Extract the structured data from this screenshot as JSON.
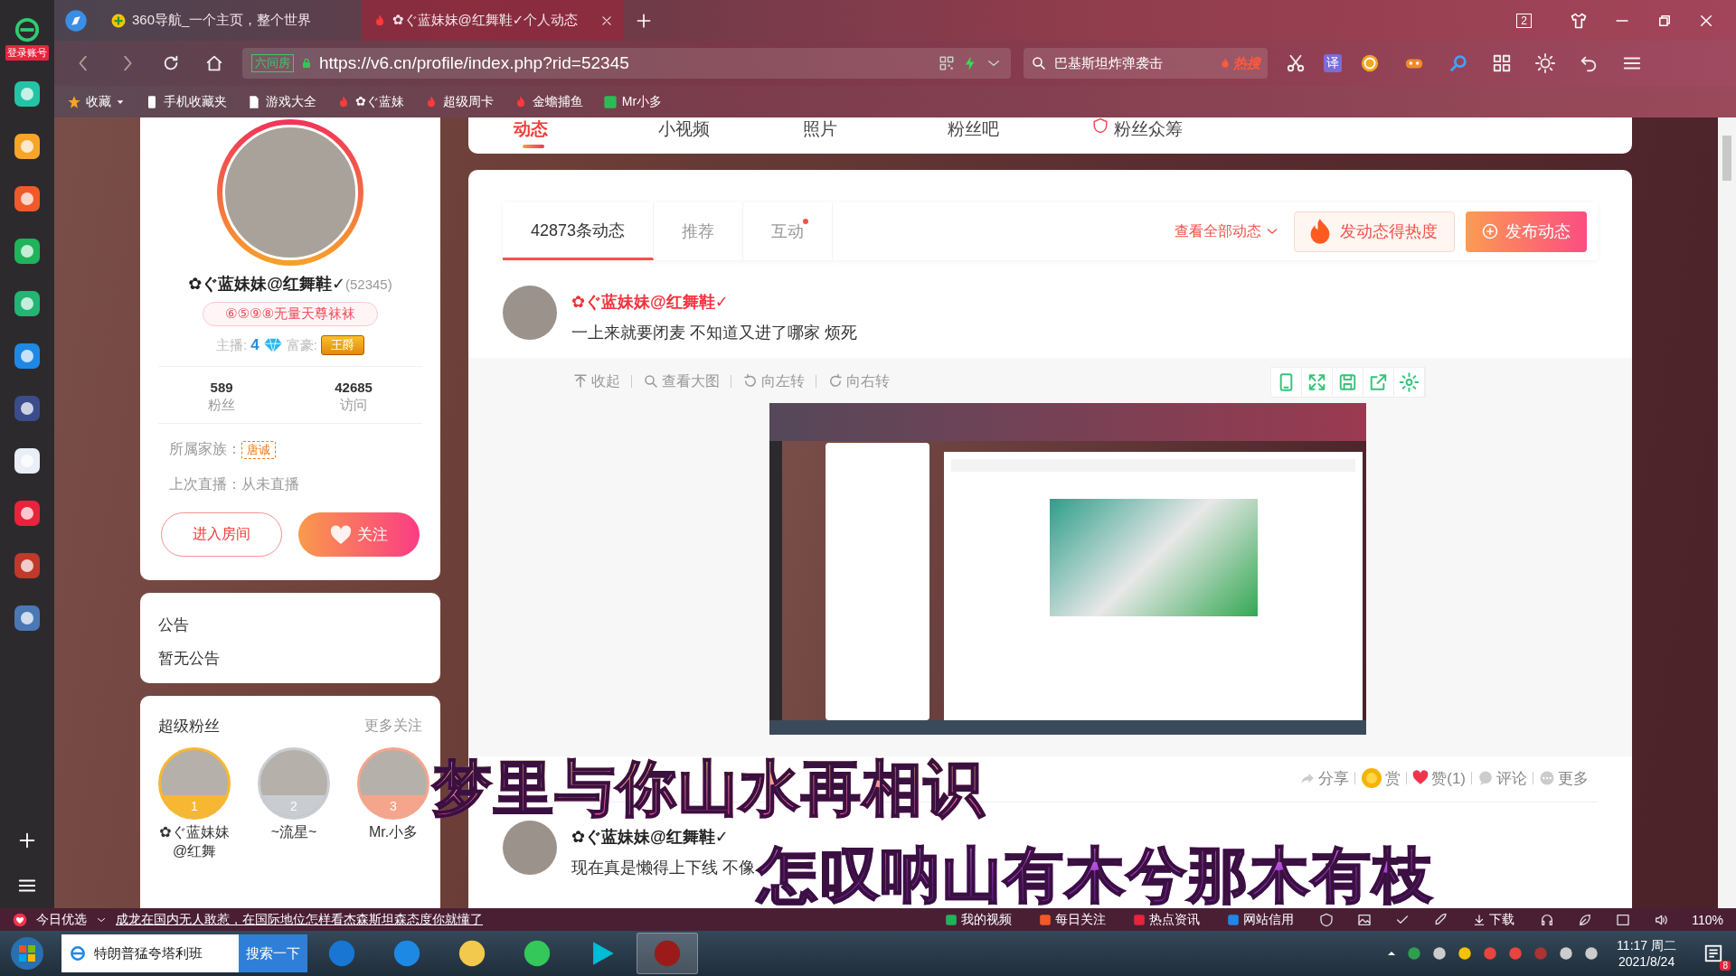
{
  "browser": {
    "tabs": [
      {
        "title": "360导航_一个主页，整个世界",
        "selected": false
      },
      {
        "title": "✿ぐ蓝妹妹@红舞鞋✓个人动态",
        "selected": true
      }
    ],
    "window_count": "2",
    "address": {
      "site_label": "六间房",
      "url": "https://v6.cn/profile/index.php?rid=52345"
    },
    "search": {
      "value": "巴基斯坦炸弹袭击",
      "hot_label": "热搜"
    },
    "translate_label": "译",
    "bookmarks": [
      {
        "label": "收藏",
        "kind": "star"
      },
      {
        "label": "手机收藏夹",
        "kind": "phone"
      },
      {
        "label": "游戏大全",
        "kind": "page"
      },
      {
        "label": "✿ぐ蓝妹",
        "kind": "six"
      },
      {
        "label": "超级周卡",
        "kind": "six"
      },
      {
        "label": "金蟾捕鱼",
        "kind": "six"
      },
      {
        "label": "Mr小多",
        "kind": "green"
      }
    ]
  },
  "sidebar": {
    "login_label": "登录账号"
  },
  "profile_nav": [
    {
      "label": "动态",
      "selected": true
    },
    {
      "label": "小视频",
      "selected": false
    },
    {
      "label": "照片",
      "selected": false
    },
    {
      "label": "粉丝吧",
      "selected": false
    },
    {
      "label": "粉丝众筹",
      "selected": false
    }
  ],
  "profile": {
    "name": "✿ぐ蓝妹妹@红舞鞋✓",
    "rid": "(52345)",
    "signature": "⑥⑤⑨⑧无量天尊袜袜",
    "anchor_label": "主播:",
    "anchor_level": "4",
    "rich_label": "富豪:",
    "rich_badge": "王爵",
    "stats": [
      {
        "value": "589",
        "label": "粉丝"
      },
      {
        "value": "42685",
        "label": "访问"
      }
    ],
    "family_label": "所属家族：",
    "family": "唐诚",
    "last_live": "上次直播：从未直播",
    "enter_button": "进入房间",
    "follow_button": "关注"
  },
  "notice": {
    "title": "公告",
    "text": "暂无公告"
  },
  "super_fans": {
    "title": "超级粉丝",
    "more": "更多关注",
    "fans": [
      {
        "rank": "1",
        "name": "✿ぐ蓝妹妹@红舞",
        "color": "#f7b733"
      },
      {
        "rank": "2",
        "name": "~流星~",
        "color": "#c9ccd1"
      },
      {
        "rank": "3",
        "name": "Mr.小多",
        "color": "#f5a58c"
      }
    ]
  },
  "feed": {
    "tabs": [
      {
        "label": "42873条动态",
        "selected": true,
        "dot": false
      },
      {
        "label": "推荐",
        "selected": false,
        "dot": false
      },
      {
        "label": "互动",
        "selected": false,
        "dot": true
      }
    ],
    "view_all": "查看全部动态",
    "heat_button": "发动态得热度",
    "publish_button": "发布动态",
    "post": {
      "author": "✿ぐ蓝妹妹@红舞鞋✓",
      "text": "一上来就要闭麦 不知道又进了哪家 烦死",
      "tools": [
        "收起",
        "查看大图",
        "向左转",
        "向右转"
      ],
      "actions": [
        {
          "label": "分享",
          "kind": "share"
        },
        {
          "label": "赏",
          "kind": "reward"
        },
        {
          "label": "赞(1)",
          "kind": "like"
        },
        {
          "label": "评论",
          "kind": "comment"
        },
        {
          "label": "更多",
          "kind": "more"
        }
      ]
    },
    "next_post": {
      "author": "✿ぐ蓝妹妹@红舞鞋✓",
      "text": "现在真是懒得上下线 不像"
    }
  },
  "lyrics": [
    "梦里与你山水再相识",
    "怎叹呐山有木兮那木有枝"
  ],
  "status_bar": {
    "news_label": "今日优选",
    "headline": "成龙在国内无人敢惹，在国际地位怎样看杰森斯坦森态度你就懂了",
    "items": [
      "我的视频",
      "每日关注",
      "热点资讯",
      "网站信用"
    ],
    "download": "下载",
    "zoom": "110%"
  },
  "taskbar": {
    "search_value": "特朗普猛夸塔利班",
    "search_button": "搜索一下",
    "time": "11:17 周二",
    "date": "2021/8/24",
    "notification_count": "8"
  }
}
